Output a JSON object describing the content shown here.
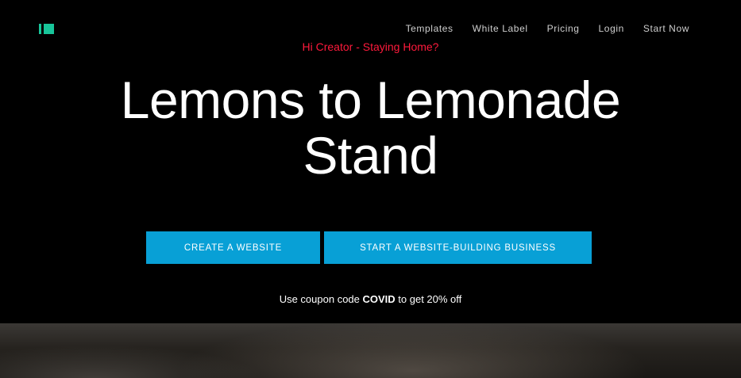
{
  "nav": {
    "items": [
      {
        "label": "Templates"
      },
      {
        "label": "White Label"
      },
      {
        "label": "Pricing"
      },
      {
        "label": "Login"
      },
      {
        "label": "Start Now"
      }
    ]
  },
  "promo": {
    "text": "Hi Creator - Staying Home?"
  },
  "headline": {
    "line1": "Lemons to Lemonade",
    "line2": "Stand"
  },
  "cta": {
    "create_label": "CREATE A WEBSITE",
    "business_label": "START A WEBSITE-BUILDING BUSINESS"
  },
  "coupon": {
    "prefix": "Use coupon code ",
    "code": "COVID",
    "suffix": " to get 20% off"
  },
  "colors": {
    "background": "#000000",
    "logo": "#18c59a",
    "promo": "#ff1a3c",
    "button": "#08a0d6"
  }
}
